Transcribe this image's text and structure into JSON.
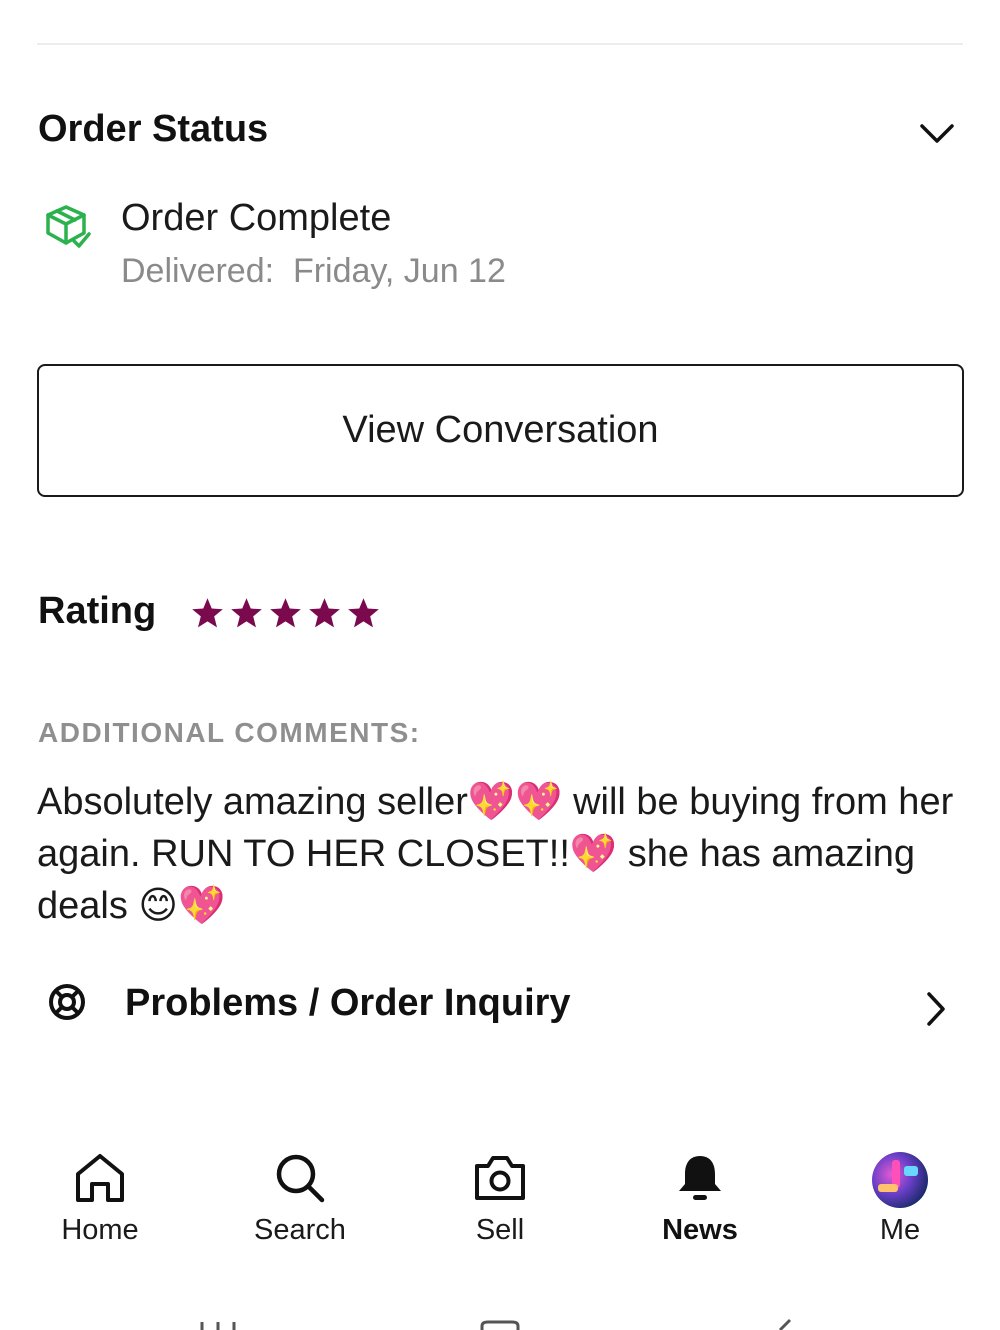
{
  "order_status": {
    "title": "Order Status",
    "status_title": "Order Complete",
    "delivered_text": "Delivered:  Friday, Jun 12",
    "accent_color": "#2bb24c"
  },
  "actions": {
    "view_conversation_label": "View Conversation"
  },
  "rating": {
    "label": "Rating",
    "stars": 5,
    "star_color": "#7a0a4d"
  },
  "comments": {
    "label": "ADDITIONAL COMMENTS:",
    "text": "Absolutely amazing seller💖💖 will be buying from her again. RUN TO HER CLOSET!!💖 she has amazing deals 😊💖"
  },
  "problems": {
    "label": "Problems / Order Inquiry"
  },
  "bottom_nav": {
    "items": [
      {
        "label": "Home",
        "icon": "home-icon"
      },
      {
        "label": "Search",
        "icon": "search-icon"
      },
      {
        "label": "Sell",
        "icon": "camera-icon"
      },
      {
        "label": "News",
        "icon": "bell-icon"
      },
      {
        "label": "Me",
        "icon": "avatar"
      }
    ],
    "active": "News"
  }
}
